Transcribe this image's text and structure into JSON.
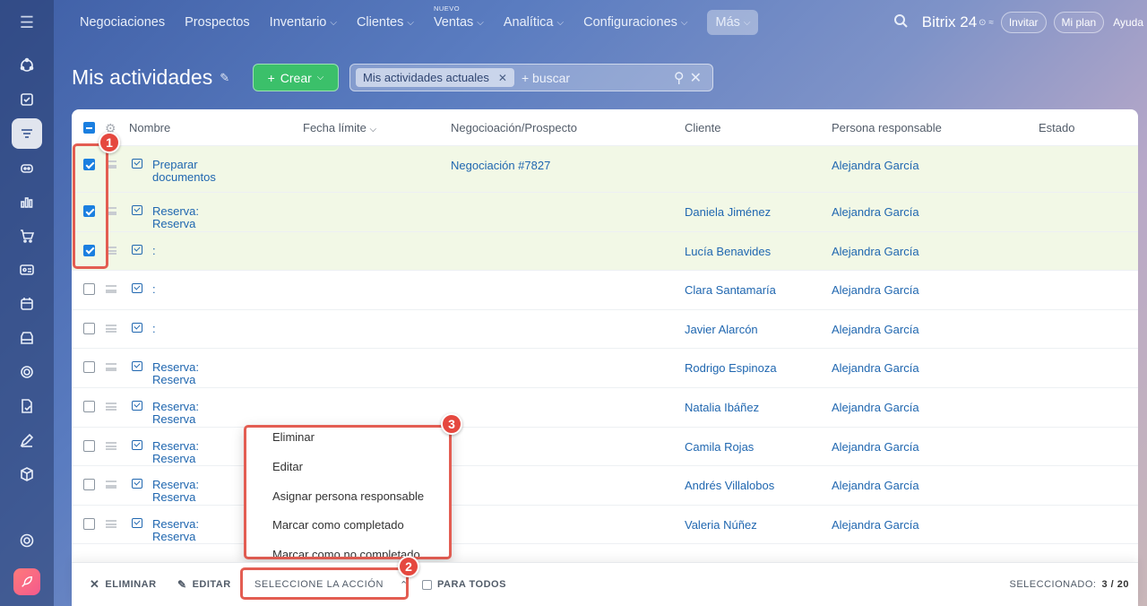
{
  "nav": {
    "items": [
      {
        "label": "Negociaciones",
        "chevron": false
      },
      {
        "label": "Prospectos",
        "chevron": false
      },
      {
        "label": "Inventario",
        "chevron": true
      },
      {
        "label": "Clientes",
        "chevron": true
      },
      {
        "label": "Ventas",
        "chevron": true,
        "badge": "NUEVO"
      },
      {
        "label": "Analítica",
        "chevron": true
      },
      {
        "label": "Configuraciones",
        "chevron": true
      },
      {
        "label": "Más",
        "chevron": true,
        "active": true
      }
    ],
    "brand": "Bitrix 24",
    "invite": "Invitar",
    "plan": "Mi plan",
    "help": "Ayuda"
  },
  "header": {
    "title": "Mis actividades",
    "create_label": "Crear",
    "filter_chip": "Mis actividades actuales",
    "search_placeholder": "+ buscar"
  },
  "table": {
    "columns": {
      "name": "Nombre",
      "deadline": "Fecha límite",
      "deal": "Negocioación/Prospecto",
      "client": "Cliente",
      "responsible": "Persona responsable",
      "status": "Estado"
    },
    "rows": [
      {
        "name": "Preparar documentos",
        "deal": "Negociación #7827",
        "client": "",
        "responsible": "Alejandra García",
        "selected": true
      },
      {
        "name": "Reserva: Reserva",
        "deal": "",
        "client": "Daniela Jiménez",
        "responsible": "Alejandra García",
        "selected": true
      },
      {
        "name": ":",
        "deal": "",
        "client": "Lucía Benavides",
        "responsible": "Alejandra García",
        "selected": true
      },
      {
        "name": ":",
        "deal": "",
        "client": "Clara Santamaría",
        "responsible": "Alejandra García",
        "selected": false
      },
      {
        "name": ":",
        "deal": "",
        "client": "Javier Alarcón",
        "responsible": "Alejandra García",
        "selected": false
      },
      {
        "name": "Reserva: Reserva",
        "deal": "",
        "client": "Rodrigo Espinoza",
        "responsible": "Alejandra García",
        "selected": false
      },
      {
        "name": "Reserva: Reserva",
        "deal": "",
        "client": "Natalia Ibáñez",
        "responsible": "Alejandra García",
        "selected": false
      },
      {
        "name": "Reserva: Reserva",
        "deal": "",
        "client": "Camila Rojas",
        "responsible": "Alejandra García",
        "selected": false
      },
      {
        "name": "Reserva: Reserva",
        "deal": "",
        "client": "Andrés Villalobos",
        "responsible": "Alejandra García",
        "selected": false
      },
      {
        "name": "Reserva: Reserva",
        "deal": "",
        "client": "Valeria Núñez",
        "responsible": "Alejandra García",
        "selected": false
      }
    ]
  },
  "dropdown": {
    "items": [
      "Eliminar",
      "Editar",
      "Asignar persona responsable",
      "Marcar como completado",
      "Marcar como no completado"
    ]
  },
  "bottom_bar": {
    "delete_label": "ELIMINAR",
    "edit_label": "EDITAR",
    "select_action_label": "SELECCIONE LA ACCIÓN",
    "for_all_label": "PARA TODOS",
    "selected_label": "SELECCIONADO:",
    "selected_count": "3 / 20"
  },
  "annotations": [
    "1",
    "2",
    "3"
  ],
  "colors": {
    "accent_green": "#3bc06a",
    "link_blue": "#2067b0",
    "annotation_red": "#e35d52",
    "selected_row": "#f2f8e6"
  }
}
